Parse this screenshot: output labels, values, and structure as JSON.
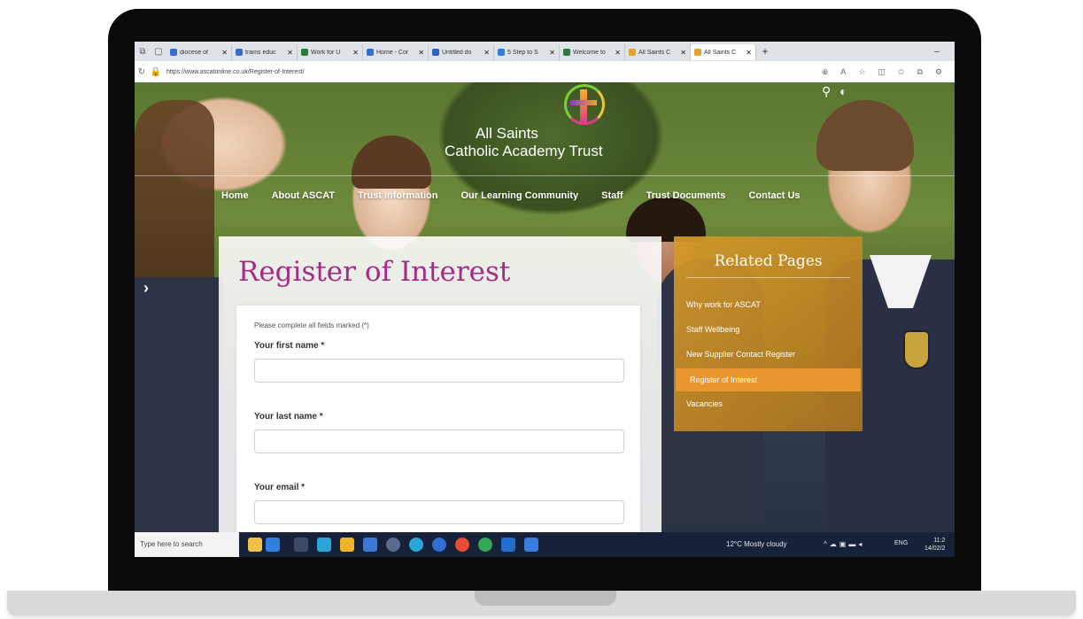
{
  "browser": {
    "tabs": [
      {
        "label": "diocese of",
        "color": "#3a6bd0"
      },
      {
        "label": "trams educ",
        "color": "#3a6bd0"
      },
      {
        "label": "Work for U",
        "color": "#2b7a3b"
      },
      {
        "label": "Home - Cor",
        "color": "#2f6fd6"
      },
      {
        "label": "Untitled do",
        "color": "#2e63c0"
      },
      {
        "label": "5 Step to S",
        "color": "#2f7fe0"
      },
      {
        "label": "Welcome to",
        "color": "#2b7a3b"
      },
      {
        "label": "All Saints C",
        "color": "#e5a12a"
      },
      {
        "label": "All Saints C",
        "color": "#e5a12a",
        "active": true
      }
    ],
    "new_tab": "+",
    "minimize": "–",
    "url": "https://www.ascatonline.co.uk/Register-of-Interest/"
  },
  "site": {
    "logo": {
      "line1": "All Saints",
      "line2": "Catholic Academy Trust"
    },
    "nav": [
      "Home",
      "About ASCAT",
      "Trust Information",
      "Our Learning Community",
      "Staff",
      "Trust Documents",
      "Contact Us"
    ],
    "page_title": "Register of Interest",
    "form": {
      "hint": "Please complete all fields marked (*)",
      "fields": [
        {
          "label": "Your first name *",
          "value": ""
        },
        {
          "label": "Your last name *",
          "value": ""
        },
        {
          "label": "Your email *",
          "value": ""
        }
      ]
    },
    "related": {
      "title": "Related Pages",
      "items": [
        "Why work for ASCAT",
        "Staff Wellbeing",
        "New Supplier Contact Register",
        "Register of Interest",
        "Vacancies"
      ],
      "active_index": 3
    }
  },
  "taskbar": {
    "search_placeholder": "Type here to search",
    "weather": "12°C Mostly cloudy",
    "language": "ENG",
    "time": "11:2",
    "date": "14/02/2"
  },
  "colors": {
    "title_magenta": "#a52b8a",
    "related_gold": "#d69a28",
    "related_active": "#e8962e",
    "taskbar": "#17223a"
  }
}
